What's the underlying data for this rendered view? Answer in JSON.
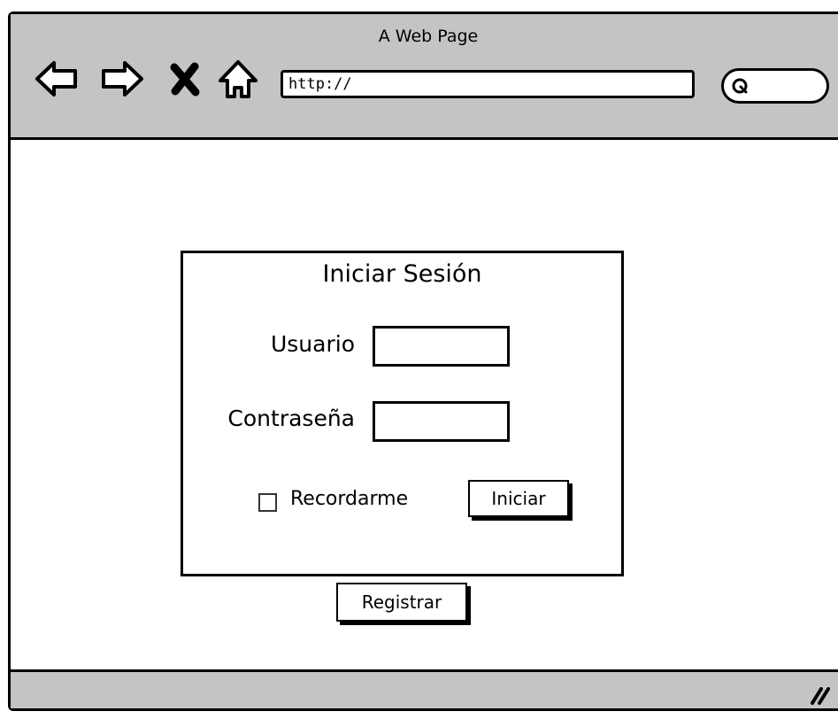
{
  "window": {
    "title": "A Web Page"
  },
  "toolbar": {
    "icons": [
      "back-arrow-icon",
      "forward-arrow-icon",
      "stop-icon",
      "home-icon"
    ],
    "url": "http://",
    "search_icon": "search-icon"
  },
  "login": {
    "title": "Iniciar Sesión",
    "username_label": "Usuario",
    "password_label": "Contraseña",
    "remember_label": "Recordarme",
    "remember_checked": false,
    "submit_label": "Iniciar"
  },
  "register_label": "Registrar",
  "colors": {
    "chrome": "#c4c4c4",
    "border": "#000000",
    "background": "#ffffff"
  }
}
